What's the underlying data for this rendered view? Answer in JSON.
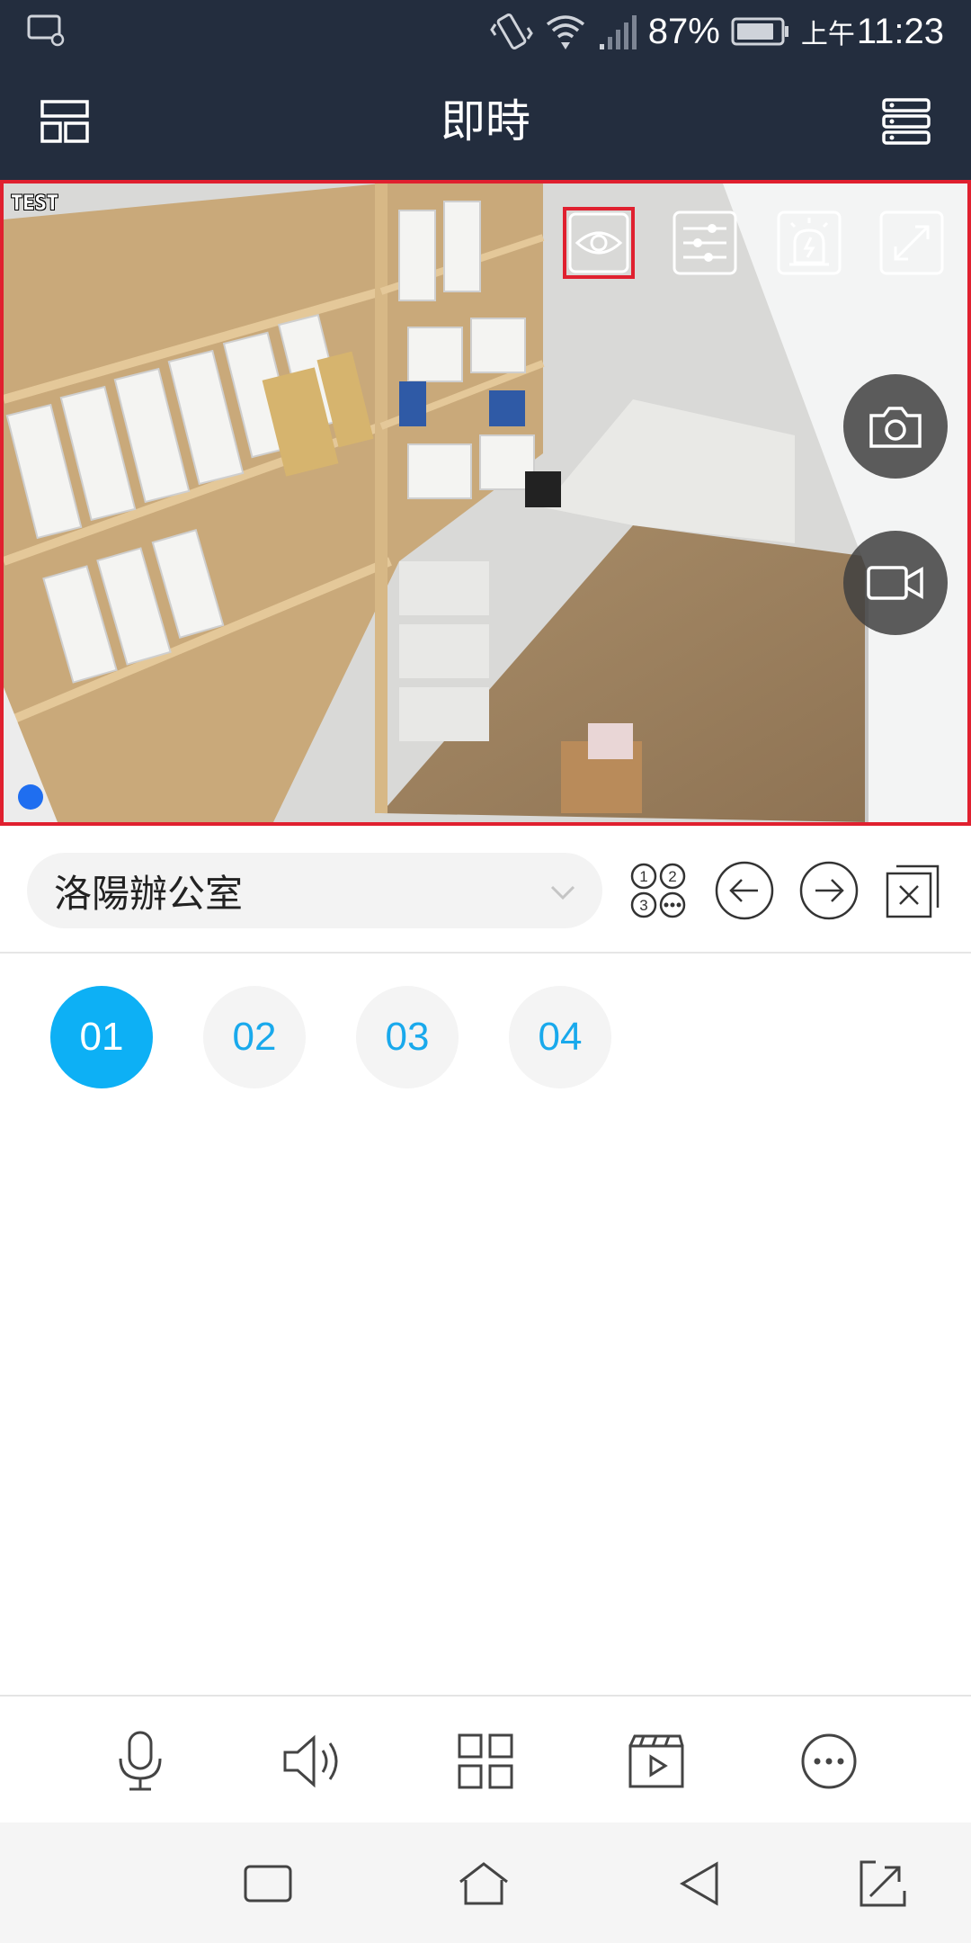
{
  "status_bar": {
    "battery_percent": "87%",
    "ampm": "上午",
    "time": "11:23"
  },
  "header": {
    "title": "即時",
    "left_icon": "layout-icon",
    "right_icon": "device-list-icon"
  },
  "live_view": {
    "osd_text": "TEST",
    "toolbar": [
      {
        "name": "eye-icon",
        "selected": true
      },
      {
        "name": "sliders-icon",
        "selected": false
      },
      {
        "name": "alarm-light-icon",
        "selected": false
      },
      {
        "name": "fullscreen-icon",
        "selected": false
      }
    ],
    "floating_buttons": [
      "camera-icon",
      "video-record-icon"
    ],
    "border_color": "#e0202f"
  },
  "site_selector": {
    "value": "洛陽辦公室",
    "chevron_icon": "chevron-down-icon"
  },
  "controls": [
    "channel-numbers-icon",
    "arrow-left-circle-icon",
    "arrow-right-circle-icon",
    "close-all-icon"
  ],
  "channels": [
    {
      "label": "01",
      "active": true
    },
    {
      "label": "02",
      "active": false
    },
    {
      "label": "03",
      "active": false
    },
    {
      "label": "04",
      "active": false
    }
  ],
  "bottom_toolbar": [
    "microphone-icon",
    "speaker-icon",
    "grid-icon",
    "playback-icon",
    "more-icon"
  ],
  "nav_bar": [
    "recent-apps-icon",
    "home-icon",
    "back-icon",
    "expand-icon"
  ],
  "colors": {
    "header_bg": "#232d3e",
    "accent": "#0db0f5",
    "accent_text": "#19a9ec",
    "highlight": "#e0202f"
  }
}
